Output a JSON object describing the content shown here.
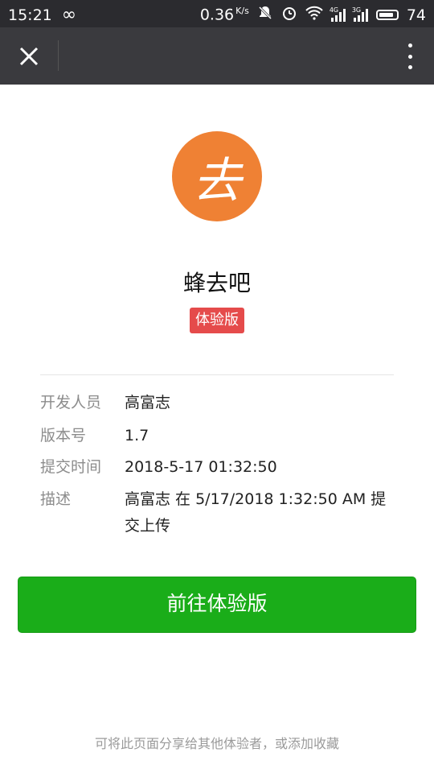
{
  "status_bar": {
    "time": "15:21",
    "link_glyph": "∞",
    "speed": "0.36",
    "speed_unit": "K/s",
    "net_4g": "4G",
    "net_3g": "3G",
    "battery": "74"
  },
  "nav": {
    "close_icon": "close-icon",
    "more_icon": "more-icon"
  },
  "app": {
    "name": "蜂去吧",
    "logo_glyph": "去",
    "badge": "体验版",
    "logo_color": "#ef8134"
  },
  "details": [
    {
      "label": "开发人员",
      "value": "高富志"
    },
    {
      "label": "版本号",
      "value": "1.7"
    },
    {
      "label": "提交时间",
      "value": "2018-5-17 01:32:50"
    },
    {
      "label": "描述",
      "value": "高富志 在 5/17/2018 1:32:50 AM 提交上传"
    }
  ],
  "primary_button": {
    "label": "前往体验版",
    "color": "#1aad19"
  },
  "footer_note": "可将此页面分享给其他体验者，或添加收藏"
}
